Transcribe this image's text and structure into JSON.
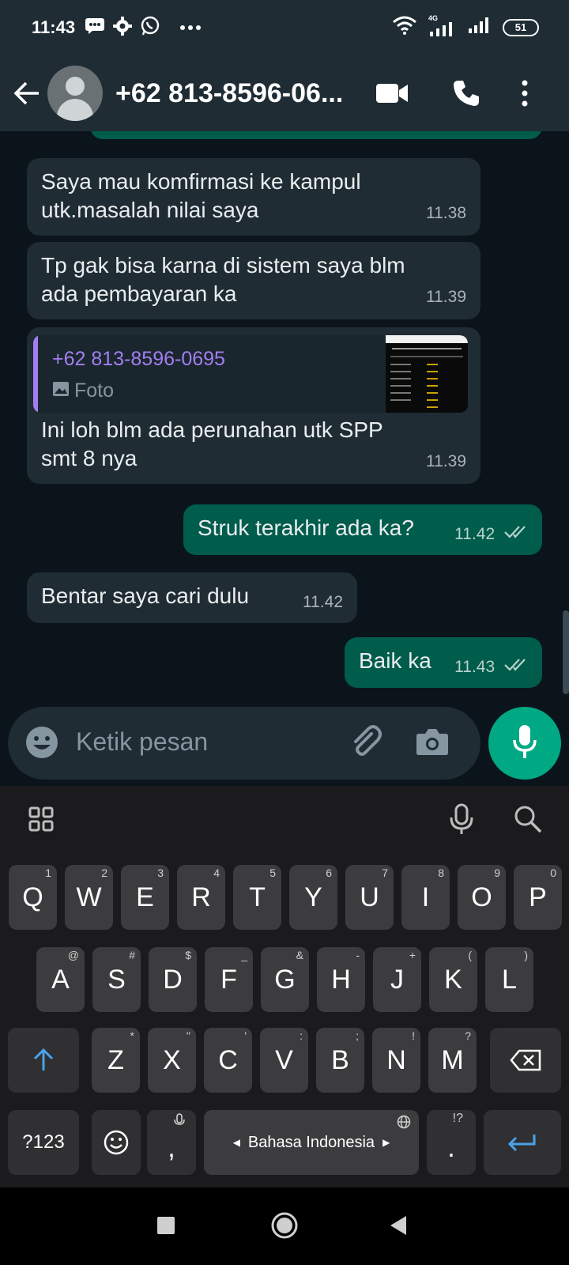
{
  "status_bar": {
    "time": "11:43",
    "network": "4G",
    "battery": "51",
    "icons": [
      "message-icon",
      "settings-icon",
      "whatsapp-icon",
      "more-dots-icon",
      "wifi-icon",
      "signal-icon",
      "signal-icon-2",
      "battery-icon"
    ]
  },
  "header": {
    "contact_name": "+62 813-8596-06...",
    "icons": [
      "back-arrow-icon",
      "avatar",
      "video-call-icon",
      "voice-call-icon",
      "menu-kebab-icon"
    ]
  },
  "messages": [
    {
      "direction": "in",
      "text_lines": [
        "Saya mau komfirmasi ke kampul",
        "utk.masalah nilai saya"
      ],
      "time": "11.38"
    },
    {
      "direction": "in",
      "text_lines": [
        "Tp gak bisa karna di sistem saya blm",
        "ada pembayaran ka"
      ],
      "time": "11.39"
    },
    {
      "direction": "in",
      "quote": {
        "name": "+62 813-8596-0695",
        "type": "Foto"
      },
      "text_lines": [
        "Ini loh blm ada perunahan utk SPP",
        "smt 8 nya"
      ],
      "time": "11.39"
    },
    {
      "direction": "out",
      "text_lines": [
        "Struk terakhir ada ka?"
      ],
      "time": "11.42",
      "status": "read"
    },
    {
      "direction": "in",
      "text_lines": [
        "Bentar saya cari dulu"
      ],
      "time": "11.42"
    },
    {
      "direction": "out",
      "text_lines": [
        "Baik ka"
      ],
      "time": "11.43",
      "status": "read"
    }
  ],
  "composer": {
    "placeholder": "Ketik pesan"
  },
  "keyboard": {
    "row1": [
      {
        "k": "Q",
        "h": "1"
      },
      {
        "k": "W",
        "h": "2"
      },
      {
        "k": "E",
        "h": "3"
      },
      {
        "k": "R",
        "h": "4"
      },
      {
        "k": "T",
        "h": "5"
      },
      {
        "k": "Y",
        "h": "6"
      },
      {
        "k": "U",
        "h": "7"
      },
      {
        "k": "I",
        "h": "8"
      },
      {
        "k": "O",
        "h": "9"
      },
      {
        "k": "P",
        "h": "0"
      }
    ],
    "row2": [
      {
        "k": "A",
        "h": "@"
      },
      {
        "k": "S",
        "h": "#"
      },
      {
        "k": "D",
        "h": "$"
      },
      {
        "k": "F",
        "h": "_"
      },
      {
        "k": "G",
        "h": "&"
      },
      {
        "k": "H",
        "h": "-"
      },
      {
        "k": "J",
        "h": "+"
      },
      {
        "k": "K",
        "h": "("
      },
      {
        "k": "L",
        "h": ")"
      }
    ],
    "row3": [
      {
        "k": "Z",
        "h": "*"
      },
      {
        "k": "X",
        "h": "\""
      },
      {
        "k": "C",
        "h": "'"
      },
      {
        "k": "V",
        "h": ":"
      },
      {
        "k": "B",
        "h": ";"
      },
      {
        "k": "N",
        "h": "!"
      },
      {
        "k": "M",
        "h": "?"
      }
    ],
    "symbols_label": "?123",
    "comma": ",",
    "period": ".",
    "period_hint": "!?",
    "space_label": "Bahasa Indonesia"
  },
  "colors": {
    "header_bg": "#1f2c34",
    "chat_bg": "#0b141a",
    "incoming_bubble": "#202c33",
    "outgoing_bubble": "#005c4b",
    "accent": "#00a884",
    "quote_name": "#a37ef2",
    "read_ticks": "#b6d3cc"
  }
}
